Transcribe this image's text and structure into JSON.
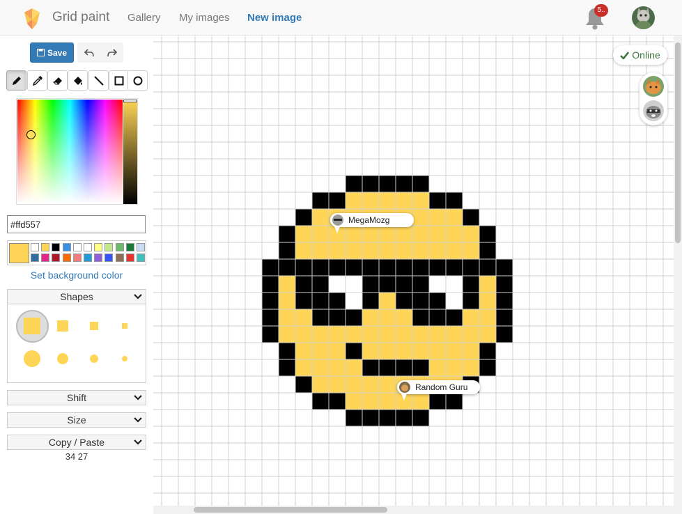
{
  "header": {
    "brand": "Grid paint",
    "nav": [
      {
        "label": "Gallery",
        "active": false
      },
      {
        "label": "My images",
        "active": false
      },
      {
        "label": "New image",
        "active": true
      }
    ],
    "notification_count": "5..",
    "icons": {
      "logo": "paint-brush-logo",
      "bell": "bell-icon",
      "avatar": "user-avatar"
    }
  },
  "toolbar": {
    "save_label": "Save",
    "undo_icon": "undo-icon",
    "redo_icon": "redo-icon",
    "tools": [
      "pencil",
      "eyedropper",
      "eraser",
      "fill-bucket",
      "line",
      "rectangle",
      "circle"
    ],
    "active_tool": "pencil"
  },
  "color": {
    "hex_value": "#ffd557",
    "current": "#ffd557",
    "palette_row1": [
      "#ffffff",
      "#ffd557",
      "#000000",
      "#3a8ee6",
      "#ffffff",
      "#ffffff",
      "#ffff88",
      "#c4e88c",
      "#6fb96a",
      "#1b7a3a",
      "#c9dcf5"
    ],
    "palette_row2": [
      "#2e6ea1",
      "#e0268a",
      "#b0172a",
      "#ff6a00",
      "#f07e7e",
      "#1e9cd8",
      "#8f5fd8",
      "#3355ff",
      "#8c6d55",
      "#e83333",
      "#3fc0c0"
    ],
    "background_link": "Set background color"
  },
  "panels": {
    "shapes": "Shapes",
    "shift": "Shift",
    "size": "Size",
    "copy_paste": "Copy / Paste"
  },
  "coords": "34 27",
  "presence": {
    "status": "Online",
    "users": [
      "orange-cat-avatar",
      "raccoon-avatar"
    ]
  },
  "cursors": [
    {
      "name": "MegaMozg"
    },
    {
      "name": "Random Guru"
    }
  ],
  "pixel_art": {
    "yellow": "#ffd557",
    "black": "#000000",
    "white": "#ffffff",
    "rows": [
      "....KKKKK....",
      "..KKYYYYYKK..",
      ".KYYYYYYYYYK.",
      ".KYYYYYYYYYK.",
      "KKKKKKKKKKKKKKK",
      "KYKWWKKKKKWWKKYK",
      "KYKKWKKYKKKWKYK"
    ]
  }
}
